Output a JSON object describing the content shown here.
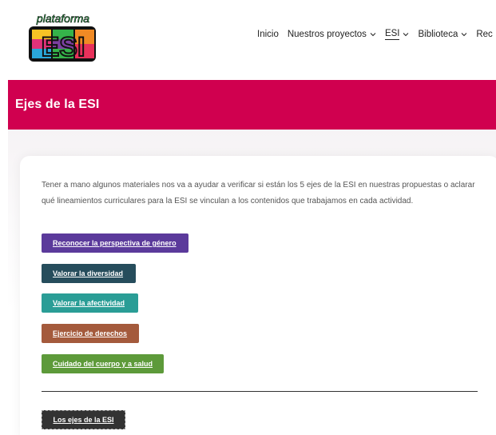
{
  "logo": {
    "top_text": "plataforma",
    "main_text": "ESI"
  },
  "nav": {
    "items": [
      {
        "label": "Inicio",
        "has_dropdown": false,
        "active": false
      },
      {
        "label": "Nuestros proyectos",
        "has_dropdown": true,
        "active": false
      },
      {
        "label": "ESI",
        "has_dropdown": true,
        "active": true
      },
      {
        "label": "Biblioteca",
        "has_dropdown": true,
        "active": false
      },
      {
        "label": "Rec",
        "has_dropdown": false,
        "active": false
      }
    ]
  },
  "banner": {
    "title": "Ejes de la ESI",
    "color": "#d0004f"
  },
  "content": {
    "intro": "Tener a mano algunos materiales nos va a ayudar a verificar si están los 5 ejes de la ESI en nuestras propuestas o aclarar qué lineamientos curriculares para la ESI se vinculan a los contenidos que trabajamos en cada actividad.",
    "buttons": [
      {
        "label": "Reconocer la perspectiva de género",
        "color": "#5b3a9b"
      },
      {
        "label": "Valorar la diversidad",
        "color": "#264d5c"
      },
      {
        "label": "Valorar la afectividad",
        "color": "#2a9d96"
      },
      {
        "label": "Ejercicio de derechos",
        "color": "#a45a3c"
      },
      {
        "label": "Cuidado del cuerpo y a salud",
        "color": "#5d9a3a"
      }
    ],
    "footer_button": {
      "label": "Los ejes de la ESI"
    }
  }
}
